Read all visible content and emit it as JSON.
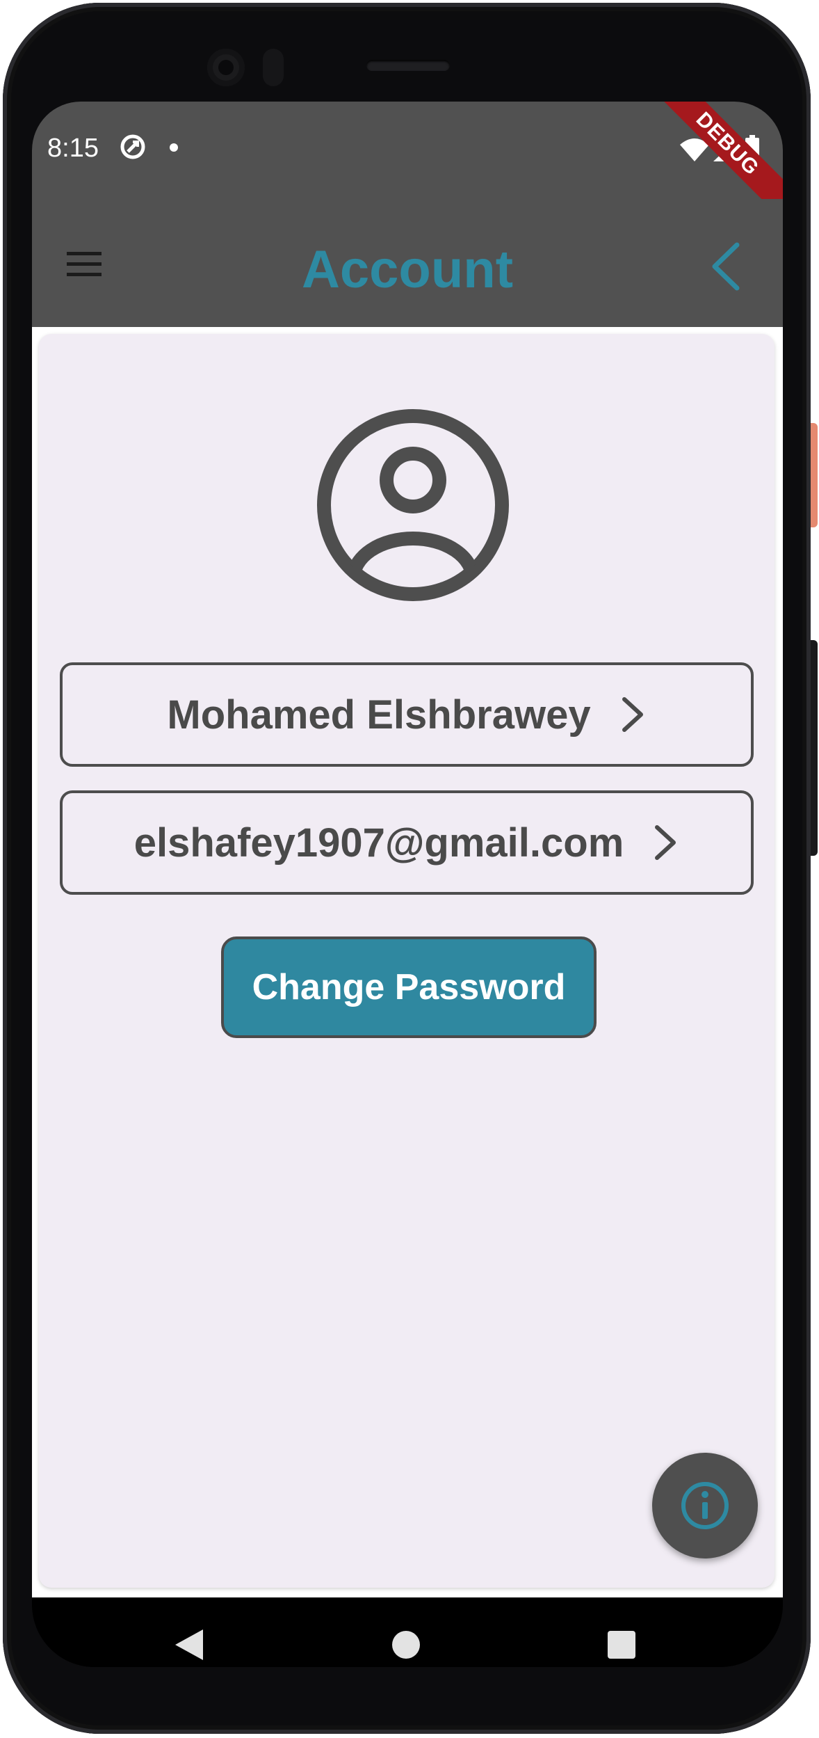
{
  "status_bar": {
    "time": "8:15",
    "debug_label": "DEBUG"
  },
  "app_bar": {
    "title": "Account",
    "menu_icon": "menu-icon",
    "back_icon": "back-chevron-icon"
  },
  "profile": {
    "avatar_icon": "account-circle-icon",
    "name": "Mohamed Elshbrawey",
    "email": "elshafey1907@gmail.com"
  },
  "actions": {
    "change_password_label": "Change Password"
  },
  "fab": {
    "icon": "info-icon"
  },
  "colors": {
    "accent": "#2e8aa2",
    "app_bar_bg": "#515151",
    "card_bg": "#f1ecf4",
    "debug_ribbon": "#a5191d"
  }
}
